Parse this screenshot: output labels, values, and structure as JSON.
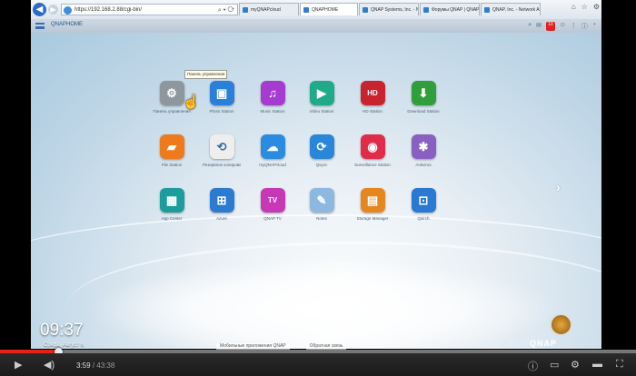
{
  "browser": {
    "address": "https://192.168.2.88/cgi-bin/",
    "tabs": [
      {
        "label": "myQNAPcloud",
        "active": false
      },
      {
        "label": "QNAPHOME",
        "active": true
      },
      {
        "label": "QNAP Systems, Inc. - Network",
        "active": false
      },
      {
        "label": "Форумы QNAP | QNAP",
        "active": false
      },
      {
        "label": "QNAP, Inc. - Network Attache...",
        "active": false
      }
    ]
  },
  "qnap": {
    "title": "QNAPHOME",
    "notifications": "10"
  },
  "apps": [
    {
      "label": "Панель управления",
      "color": "#8e969e",
      "glyph": "⚙",
      "icon": "gear-icon"
    },
    {
      "label": "Photo Station",
      "color": "#2a7fd8",
      "glyph": "▣",
      "icon": "photo-icon"
    },
    {
      "label": "Music Station",
      "color": "#a63ccf",
      "glyph": "♫",
      "icon": "music-note-icon"
    },
    {
      "label": "Video Station",
      "color": "#1faa8a",
      "glyph": "▶",
      "icon": "film-icon"
    },
    {
      "label": "HD Station",
      "color": "#c9232f",
      "glyph": "HD",
      "icon": "hd-station-icon"
    },
    {
      "label": "Download Station",
      "color": "#2f9e3b",
      "glyph": "⬇",
      "icon": "download-icon"
    },
    {
      "label": "File Station",
      "color": "#ef7a1b",
      "glyph": "▰",
      "icon": "folder-icon"
    },
    {
      "label": "Резервное копирование",
      "color": "#eeeeee",
      "glyph": "⟲",
      "icon": "backup-icon"
    },
    {
      "label": "myQNAPcloud",
      "color": "#2b8be0",
      "glyph": "☁",
      "icon": "cloud-icon"
    },
    {
      "label": "Qsync",
      "color": "#2a86d8",
      "glyph": "⟳",
      "icon": "sync-icon"
    },
    {
      "label": "Surveillance Station",
      "color": "#e12b4a",
      "glyph": "◉",
      "icon": "camera-icon"
    },
    {
      "label": "Antivirus",
      "color": "#8a5fc2",
      "glyph": "✱",
      "icon": "antivirus-icon"
    },
    {
      "label": "App Center",
      "color": "#1c9c9c",
      "glyph": "▦",
      "icon": "app-center-icon"
    },
    {
      "label": "Azure",
      "color": "#2d7bd0",
      "glyph": "⊞",
      "icon": "azure-icon"
    },
    {
      "label": "QNAP TV",
      "color": "#c638b6",
      "glyph": "TV",
      "icon": "tv-icon"
    },
    {
      "label": "Notes",
      "color": "#8fb8e0",
      "glyph": "✎",
      "icon": "notes-icon"
    },
    {
      "label": "Storage Manager",
      "color": "#e6861f",
      "glyph": "▤",
      "icon": "storage-icon"
    },
    {
      "label": "Qsirch",
      "color": "#2a78d2",
      "glyph": "⊡",
      "icon": "search-app-icon"
    }
  ],
  "tooltip": "Панель управления",
  "dock": {
    "item1": "Мобильные приложения QNAP",
    "item2": "Обратная связь"
  },
  "overlay": {
    "clock": "09:37",
    "date": "Среда, Август 6"
  },
  "brand": "QNAP",
  "player": {
    "current_time": "3:59",
    "separator": "/",
    "duration": "43:38",
    "progress_fraction": 0.0915
  }
}
